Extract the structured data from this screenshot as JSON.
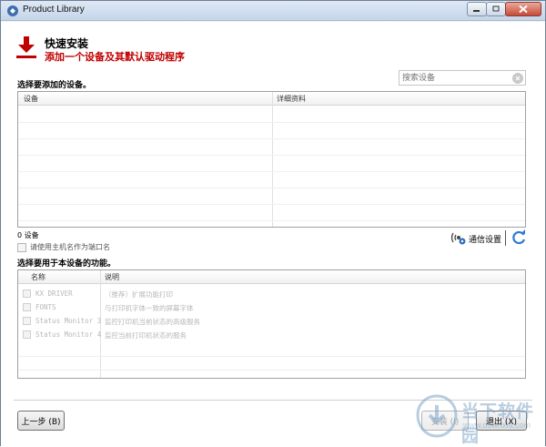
{
  "window": {
    "title": "Product Library",
    "controls": [
      "minimize",
      "restore",
      "close"
    ]
  },
  "header": {
    "title": "快速安装",
    "subtitle": "添加一个设备及其默认驱动程序",
    "icon": "download-arrow-icon",
    "accent_color": "#c00000"
  },
  "search": {
    "placeholder": "搜索设备",
    "value": ""
  },
  "devices_section": {
    "label": "选择要添加的设备。",
    "columns": [
      "设备",
      "详细资料"
    ],
    "rows": [],
    "count_text": "0  设备",
    "use_hostname_label": "请使用主机名作为端口名",
    "use_hostname_checked": false
  },
  "comm": {
    "settings_label": "通信设置",
    "icon": "network-settings-icon",
    "refresh_icon": "refresh-icon"
  },
  "functions_section": {
    "label": "选择要用于本设备的功能。",
    "columns": [
      "名称",
      "说明"
    ],
    "rows": [
      {
        "name": "KX DRIVER",
        "desc": "（推荐）扩展功能打印",
        "checked": false,
        "enabled": false
      },
      {
        "name": "FONTS",
        "desc": "与打印机字体一致的屏幕字体",
        "checked": false,
        "enabled": false
      },
      {
        "name": "Status Monitor 3",
        "desc": "监控打印机当前状态的高级服务",
        "checked": false,
        "enabled": false
      },
      {
        "name": "Status Monitor 4",
        "desc": "监控当前打印机状态的服务",
        "checked": false,
        "enabled": false
      }
    ]
  },
  "footer": {
    "back_label": "上一步 (B)",
    "install_label": "安装 (I)",
    "exit_label": "退出 (X)"
  },
  "watermark": {
    "text": "当下软件园",
    "url": "www.downxia.com"
  }
}
